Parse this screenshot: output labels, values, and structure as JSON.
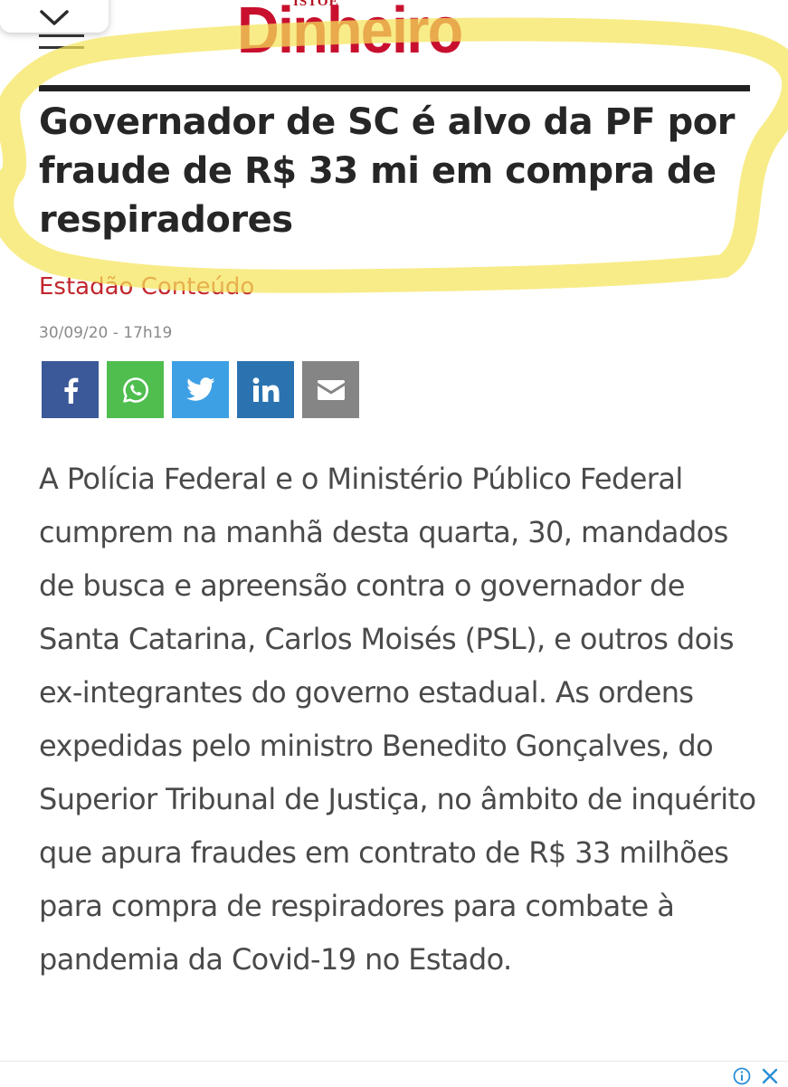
{
  "header": {
    "logo_kicker": "ISTOÉ",
    "logo_wordmark": "Dinheiro",
    "brand_color": "#c8102e"
  },
  "article": {
    "headline": "Governador de SC é alvo da PF por fraude de R$ 33 mi em compra de respiradores",
    "author": "Estadão Conteúdo",
    "timestamp": "30/09/20 - 17h19",
    "body": "A Polícia Federal e o Ministério Público Federal cumprem na manhã desta quarta, 30, mandados de busca e apreensão contra o governador de Santa Catarina, Carlos Moisés (PSL), e outros dois ex-integrantes do governo estadual. As ordens expedidas pelo ministro Benedito Gonçalves, do Superior Tribunal de Justiça, no âmbito de inquérito que apura fraudes em contrato de R$ 33 milhões para compra de respiradores para combate à pandemia da Covid-19 no Estado."
  },
  "share": [
    {
      "network": "facebook",
      "icon": "facebook-icon",
      "color": "#3b5998"
    },
    {
      "network": "whatsapp",
      "icon": "whatsapp-icon",
      "color": "#4fbe4f"
    },
    {
      "network": "twitter",
      "icon": "twitter-icon",
      "color": "#3ea0e4"
    },
    {
      "network": "linkedin",
      "icon": "linkedin-icon",
      "color": "#2a73b0"
    },
    {
      "network": "email",
      "icon": "mail-icon",
      "color": "#858585"
    }
  ],
  "ui_icons": [
    "chevron-down-icon",
    "hamburger-menu-icon",
    "ad-info-icon",
    "ad-close-icon"
  ],
  "highlight_color": "#f5e45a"
}
